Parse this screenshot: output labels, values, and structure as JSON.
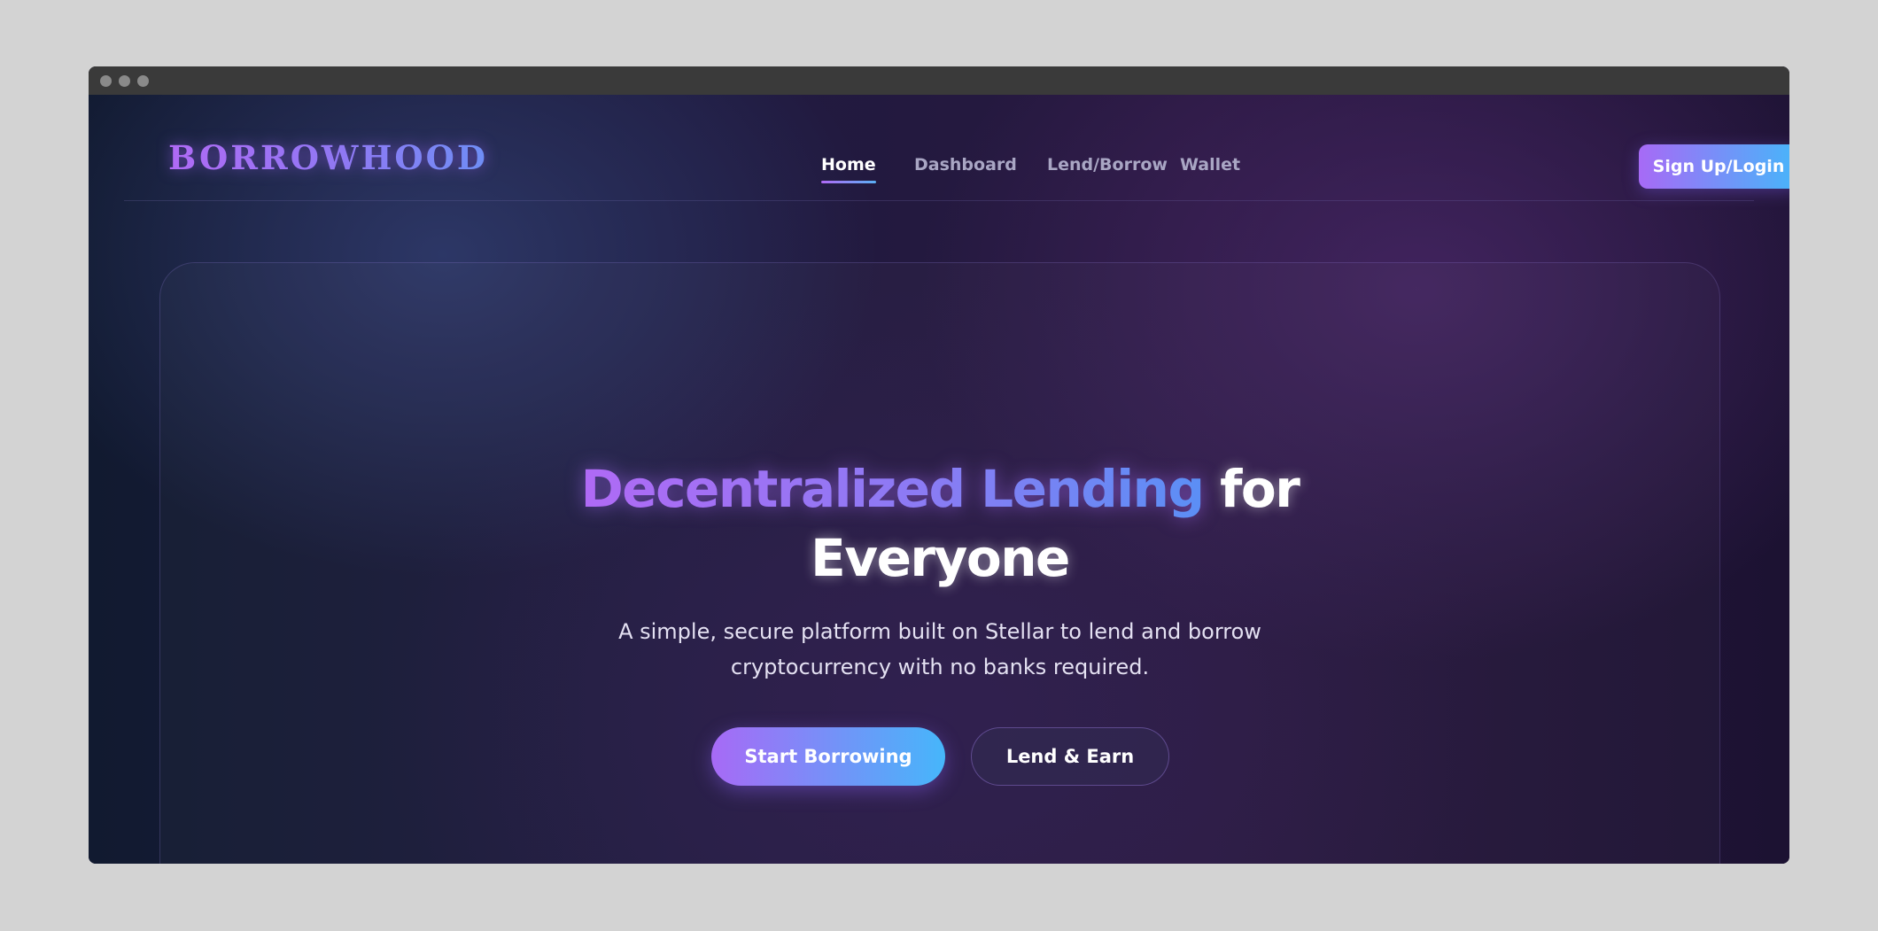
{
  "window": {
    "controls": [
      "window-dot-1",
      "window-dot-2",
      "window-dot-3"
    ]
  },
  "nav": {
    "logo": "BORROWHOOD",
    "links": [
      {
        "label": "Home",
        "active": true
      },
      {
        "label": "Dashboard",
        "active": false
      },
      {
        "label": "Lend/Borrow",
        "active": false
      },
      {
        "label": "Wallet",
        "active": false
      }
    ],
    "signup_label": "Sign Up/Login"
  },
  "hero": {
    "headline_gradient": "Decentralized Lending",
    "headline_for": "for",
    "headline_line2": "Everyone",
    "subtitle_line1": "A simple, secure platform built on Stellar to lend and borrow",
    "subtitle_line2": "cryptocurrency with no banks required.",
    "primary_cta": "Start Borrowing",
    "secondary_cta": "Lend & Earn"
  },
  "colors": {
    "accent_purple": "#a76af6",
    "accent_blue": "#46b6fa",
    "background_dark": "#1a1530",
    "text_white": "#ffffff",
    "nav_inactive": "#a9a6c4"
  }
}
